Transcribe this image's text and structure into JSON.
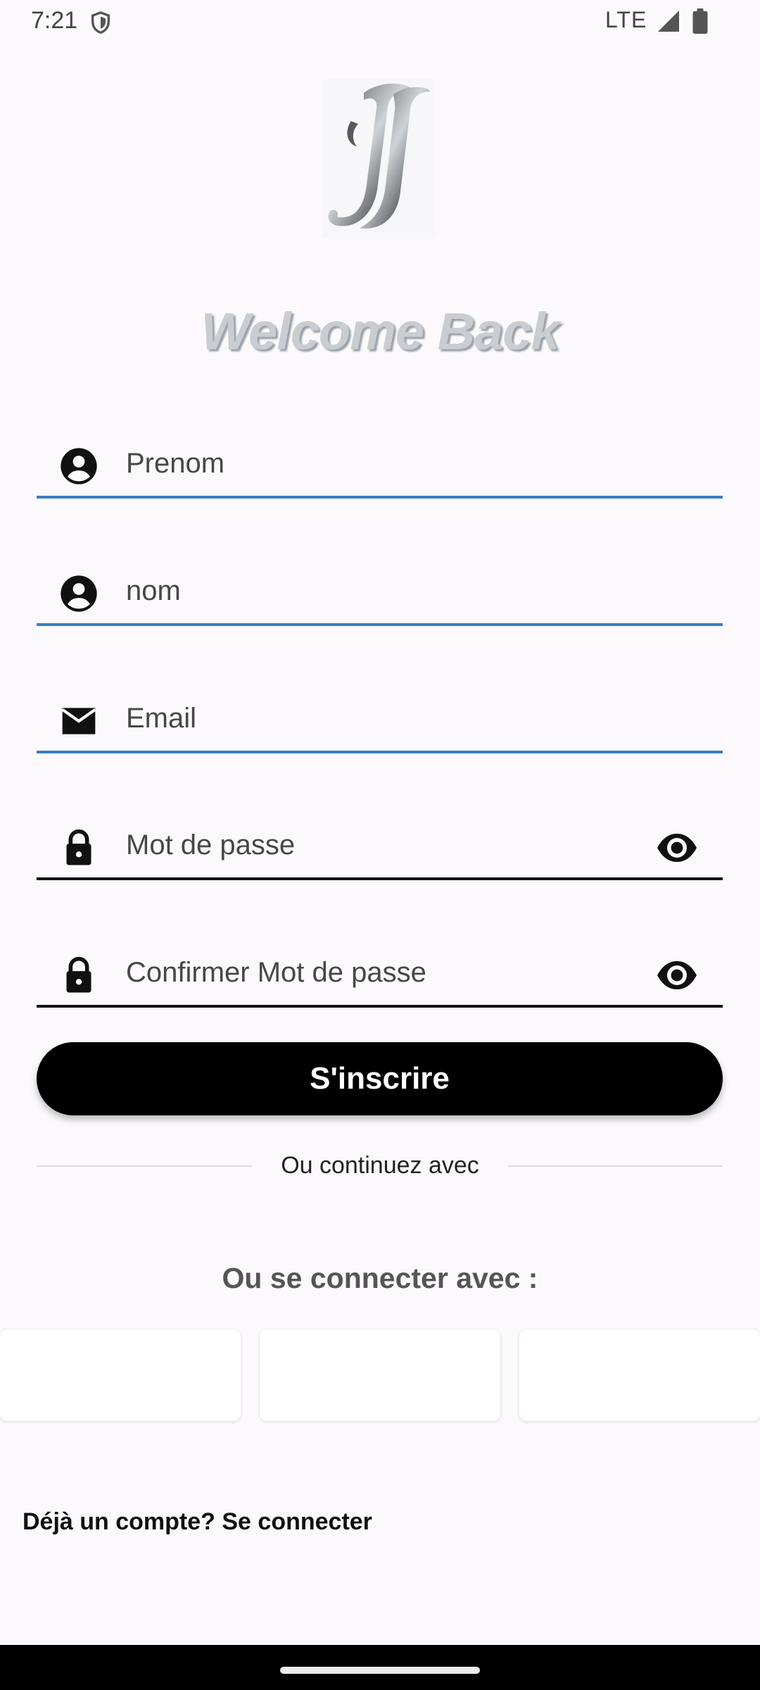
{
  "status_bar": {
    "time": "7:21",
    "network": "LTE"
  },
  "welcome_title": "Welcome Back",
  "form": {
    "first_name_placeholder": "Prenom",
    "last_name_placeholder": "nom",
    "email_placeholder": "Email",
    "password_placeholder": "Mot de passe",
    "confirm_password_placeholder": "Confirmer Mot de passe",
    "submit_label": "S'inscrire"
  },
  "divider_text": "Ou continuez avec",
  "social_title": "Ou se connecter avec :",
  "login_link": "Déjà un compte? Se connecter",
  "icons": {
    "first_name": "account-circle-icon",
    "last_name": "account-circle-icon",
    "email": "mail-icon",
    "password": "lock-icon",
    "confirm_password": "lock-icon",
    "visibility": "eye-icon"
  },
  "colors": {
    "accent_underline": "#3a7dc4",
    "button": "#000000"
  }
}
